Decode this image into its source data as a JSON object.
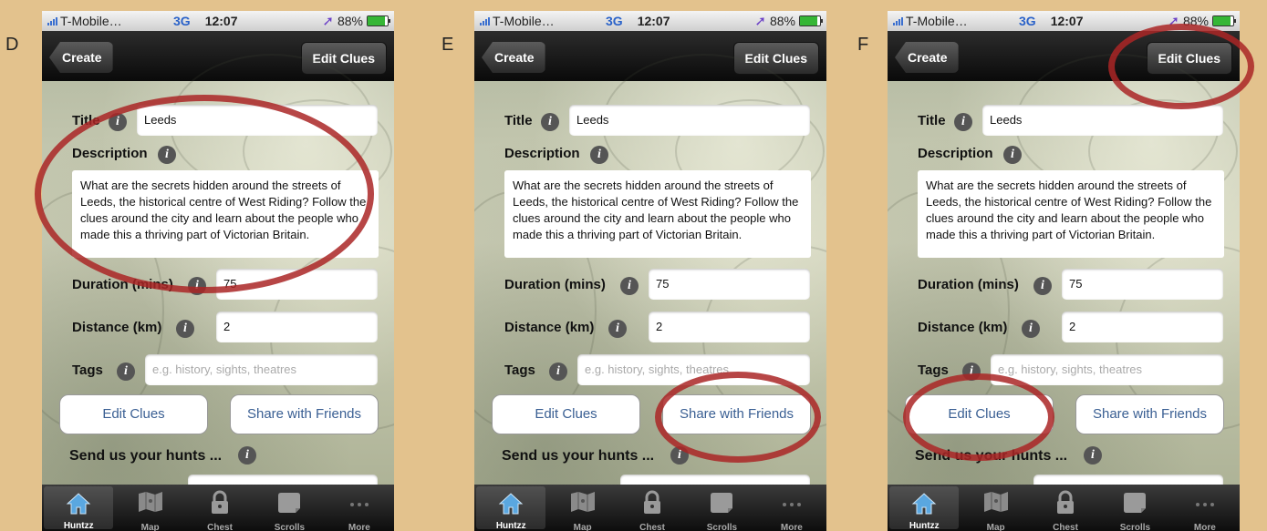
{
  "panels": [
    {
      "label": "D",
      "status": {
        "carrier": "T-Mobile…",
        "network": "3G",
        "time": "12:07",
        "battery": "88%",
        "battery_level": 0.88
      },
      "nav": {
        "back": "Create",
        "right": "Edit Clues"
      },
      "form": {
        "title_label": "Title",
        "title_value": "Leeds",
        "description_label": "Description",
        "description_text": "What are the secrets hidden around the streets of Leeds, the historical centre of West Riding? Follow the clues around the city and learn about the people who made this a thriving part of Victorian Britain.",
        "duration_label": "Duration (mins)",
        "duration_value": "75",
        "distance_label": "Distance (km)",
        "distance_value": "2",
        "tags_label": "Tags",
        "tags_placeholder": "e.g. history, sights, theatres",
        "edit_clues_button": "Edit Clues",
        "share_button": "Share with Friends",
        "send_label": "Send us your hunts ..."
      },
      "tabs": [
        "Huntzz",
        "Map",
        "Chest",
        "Scrolls",
        "More"
      ]
    },
    {
      "label": "E",
      "status": {
        "carrier": "T-Mobile…",
        "network": "3G",
        "time": "12:07",
        "battery": "88%",
        "battery_level": 0.88
      },
      "nav": {
        "back": "Create",
        "right": "Edit Clues"
      },
      "form": {
        "title_label": "Title",
        "title_value": "Leeds",
        "description_label": "Description",
        "description_text": "What are the secrets hidden around the streets of Leeds, the historical centre of West Riding? Follow the clues around the city and learn about the people who made this a thriving part of Victorian Britain.",
        "duration_label": "Duration (mins)",
        "duration_value": "75",
        "distance_label": "Distance (km)",
        "distance_value": "2",
        "tags_label": "Tags",
        "tags_placeholder": "e.g. history, sights, theatres",
        "edit_clues_button": "Edit Clues",
        "share_button": "Share with Friends",
        "send_label": "Send us your hunts ..."
      },
      "tabs": [
        "Huntzz",
        "Map",
        "Chest",
        "Scrolls",
        "More"
      ]
    },
    {
      "label": "F",
      "status": {
        "carrier": "T-Mobile…",
        "network": "3G",
        "time": "12:07",
        "battery": "88%",
        "battery_level": 0.88
      },
      "nav": {
        "back": "Create",
        "right": "Edit Clues"
      },
      "form": {
        "title_label": "Title",
        "title_value": "Leeds",
        "description_label": "Description",
        "description_text": "What are the secrets hidden around the streets of Leeds, the historical centre of West Riding? Follow the clues around the city and learn about the people who made this a thriving part of Victorian Britain.",
        "duration_label": "Duration (mins)",
        "duration_value": "75",
        "distance_label": "Distance (km)",
        "distance_value": "2",
        "tags_label": "Tags",
        "tags_placeholder": "e.g. history, sights, theatres",
        "edit_clues_button": "Edit Clues",
        "share_button": "Share with Friends",
        "send_label": "Send us your hunts ..."
      },
      "tabs": [
        "Huntzz",
        "Map",
        "Chest",
        "Scrolls",
        "More"
      ]
    }
  ],
  "colors": {
    "highlight_ring": "#aa2626",
    "background": "#e3c28d",
    "button_text": "#3a5f93"
  },
  "icons": [
    "home-icon",
    "map-icon",
    "lock-icon",
    "scroll-icon",
    "more-dots-icon",
    "info-icon",
    "location-arrow-icon",
    "battery-icon"
  ]
}
